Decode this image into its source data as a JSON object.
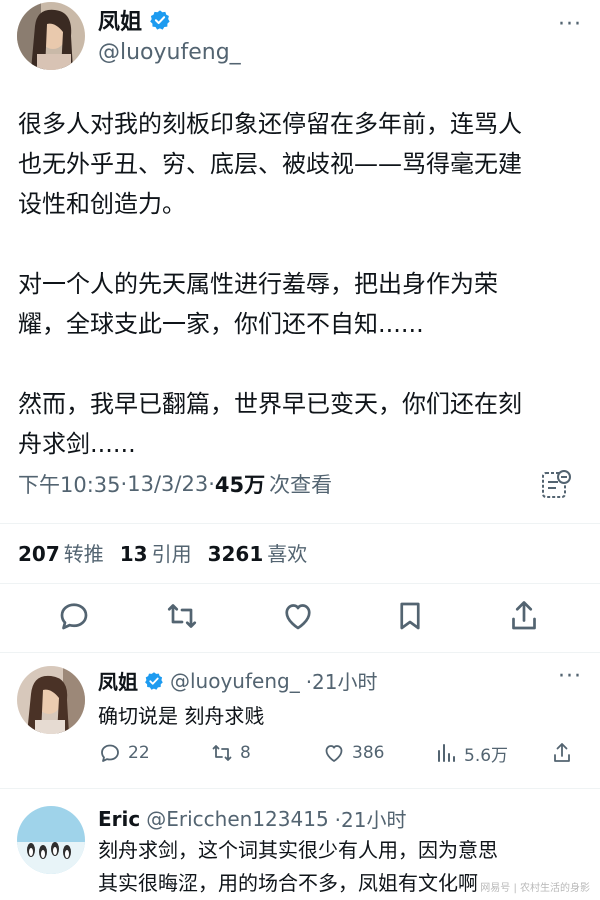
{
  "main_tweet": {
    "name": "凤姐",
    "handle": "@luoyufeng_",
    "more": "···",
    "paragraphs": [
      "很多人对我的刻板印象还停留在多年前，连骂人\n也无外乎丑、穷、底层、被歧视——骂得毫无建\n设性和创造力。",
      "对一个人的先天属性进行羞辱，把出身作为荣\n耀，全球支此一家，你们还不自知......",
      "然而，我早已翻篇，世界早已变天，你们还在刻\n舟求剑......"
    ],
    "time": "下午10:35",
    "date": "13/3/23",
    "separator": " · ",
    "views_count": "45万",
    "views_label": "次查看",
    "stats": {
      "retweets": "207",
      "retweets_label": "转推",
      "quotes": "13",
      "quotes_label": "引用",
      "likes": "3261",
      "likes_label": "喜欢"
    }
  },
  "replies": [
    {
      "name": "凤姐",
      "handle": "@luoyufeng_",
      "time": "·21小时",
      "text": "确切说是 刻舟求贱",
      "reply_count": "22",
      "retweet_count": "8",
      "like_count": "386",
      "view_count": "5.6万"
    },
    {
      "name": "Eric",
      "handle": "@Ericchen123415",
      "time": "·21小时",
      "text": "刻舟求剑，这个词其实很少有人用，因为意思\n其实很晦涩，用的场合不多，凤姐有文化啊"
    }
  ],
  "watermark": "网易号 | 农村生活的身影",
  "colors": {
    "text": "#0f1419",
    "secondary": "#536471",
    "verified": "#1d9bf0",
    "divider": "#eff3f4"
  },
  "icons": [
    "verified-icon",
    "more-icon",
    "analytics-icon",
    "reply-icon",
    "retweet-icon",
    "like-icon",
    "bookmark-icon",
    "share-icon",
    "views-icon"
  ]
}
